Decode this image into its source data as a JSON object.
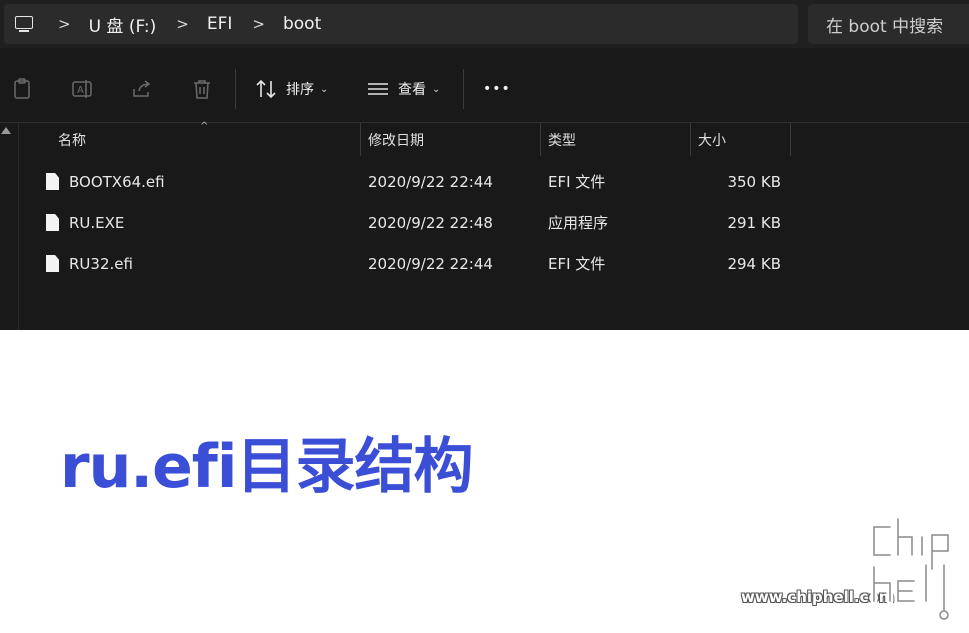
{
  "address": {
    "crumbs": [
      "U 盘 (F:)",
      "EFI",
      "boot"
    ],
    "separator": ">",
    "search_placeholder": "在 boot 中搜索"
  },
  "toolbar": {
    "sort_label": "排序",
    "view_label": "查看",
    "more_label": "•••"
  },
  "columns": {
    "name": "名称",
    "date": "修改日期",
    "type": "类型",
    "size": "大小"
  },
  "files": [
    {
      "name": "BOOTX64.efi",
      "date": "2020/9/22 22:44",
      "type": "EFI 文件",
      "size": "350 KB"
    },
    {
      "name": "RU.EXE",
      "date": "2020/9/22 22:48",
      "type": "应用程序",
      "size": "291 KB"
    },
    {
      "name": "RU32.efi",
      "date": "2020/9/22 22:44",
      "type": "EFI 文件",
      "size": "294 KB"
    }
  ],
  "caption": "ru.efi目录结构",
  "watermark": {
    "url": "www.chiphell.com",
    "logo_text": "chip hell"
  },
  "colors": {
    "caption": "#3b4ed6",
    "explorer_bg": "#191919"
  }
}
